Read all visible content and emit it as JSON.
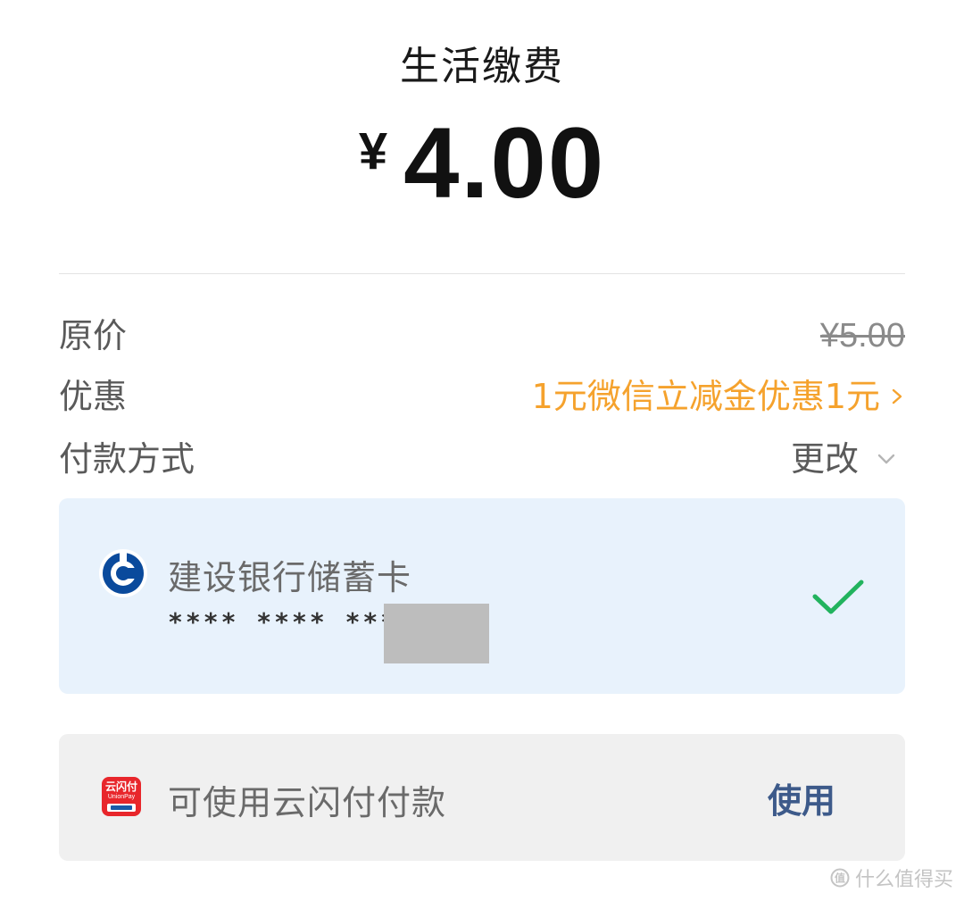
{
  "header": {
    "title": "生活缴费",
    "currency": "¥",
    "amount": "4.00"
  },
  "details": {
    "original_price_label": "原价",
    "original_price_value": "¥5.00",
    "discount_label": "优惠",
    "discount_value": "1元微信立减金优惠1元",
    "payment_method_label": "付款方式",
    "change_label": "更改"
  },
  "selected_card": {
    "bank_name": "建设银行储蓄卡",
    "card_number": "**** **** ****",
    "selected": true
  },
  "unionpay": {
    "logo_text": "云闪付",
    "logo_subtext": "UnionPay",
    "label": "可使用云闪付付款",
    "action": "使用"
  },
  "watermark": {
    "text": "什么值得买"
  },
  "colors": {
    "discount": "#f5a22d",
    "selected_card_bg": "#e8f2fc",
    "check": "#22b35e",
    "use_button": "#3d5a8a",
    "unionpay_red": "#e8262b",
    "ccb_blue": "#0a4a9c"
  }
}
